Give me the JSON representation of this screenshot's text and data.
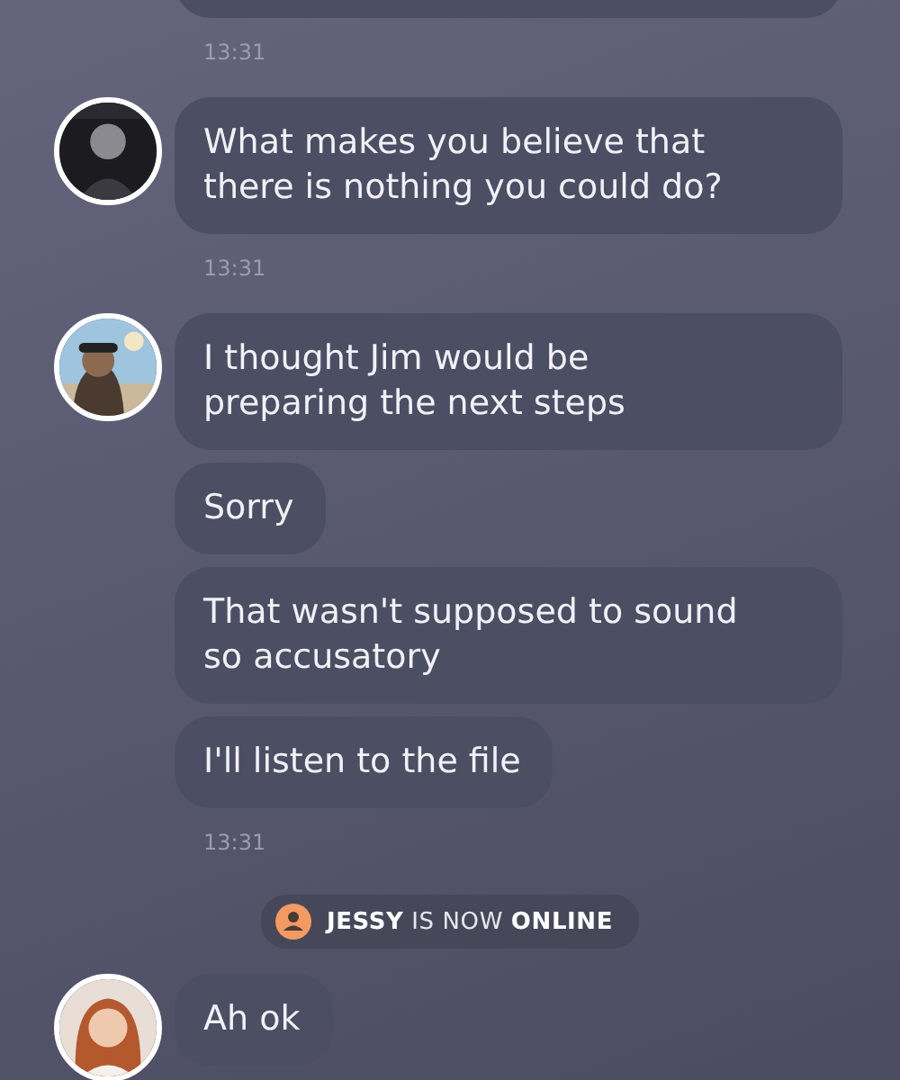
{
  "groups": [
    {
      "messages": [
        {
          "kind": "cut"
        }
      ],
      "time": "13:31"
    },
    {
      "messages": [
        {
          "kind": "text",
          "text": "What makes you believe that there is nothing you could do?"
        }
      ],
      "time": "13:31"
    },
    {
      "messages": [
        {
          "kind": "text",
          "text": "I thought Jim would be preparing the next steps"
        },
        {
          "kind": "text",
          "text": "Sorry"
        },
        {
          "kind": "text",
          "text": "That wasn't supposed to sound so accusatory"
        },
        {
          "kind": "text",
          "text": "I'll listen to the file"
        }
      ],
      "time": "13:31"
    }
  ],
  "notice": {
    "text": "**JESSY** IS NOW **ONLINE**"
  },
  "last_group": {
    "messages": [
      {
        "kind": "text",
        "text": "Ah ok"
      }
    ]
  }
}
